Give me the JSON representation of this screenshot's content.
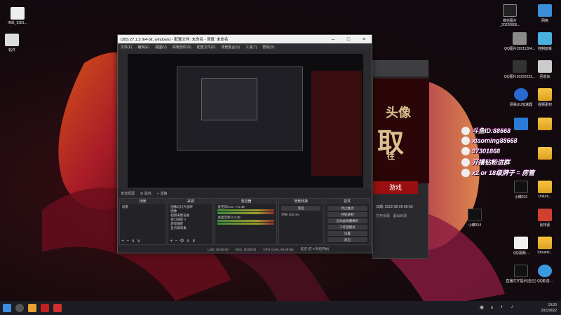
{
  "desktop": {
    "icons": [
      {
        "label": "IMG_5381..."
      },
      {
        "label": "帖件"
      },
      {
        "label": "微信图片_20220805..."
      },
      {
        "label": "网络"
      },
      {
        "label": "QQ图片20211204..."
      },
      {
        "label": "控制面板"
      },
      {
        "label": "QQ图片20220223..."
      },
      {
        "label": "回收站"
      },
      {
        "label": "网易UU加速器"
      },
      {
        "label": "视频素材"
      },
      {
        "label": "小精232"
      },
      {
        "label": "Unturn..."
      },
      {
        "label": "小精314"
      },
      {
        "label": "比特素"
      },
      {
        "label": "QQ视频..."
      },
      {
        "label": "Streaml..."
      },
      {
        "label": "直播文字提示(自己)"
      },
      {
        "label": "QQ影音..."
      }
    ]
  },
  "overlay_lines": [
    "斗鱼ID:88668",
    "xiaoming88668",
    "97301868",
    "开播钻粉进群",
    "x2 or 18级牌子 = 房管"
  ],
  "obs": {
    "title": "OBS 27.1.3 (64-bit, windows) - 配置文件: 未命名 - 场景: 未命名",
    "menu": [
      "文件(F)",
      "编辑(E)",
      "视图(V)",
      "停靠部件(D)",
      "配置文件(P)",
      "场景集合(S)",
      "工具(T)",
      "帮助(H)"
    ],
    "source_bar": {
      "label": "未选择源",
      "props": "属性",
      "filters": "滤镜"
    },
    "docks": {
      "scenes": {
        "title": "场景",
        "items": [
          "场景"
        ]
      },
      "sources": {
        "title": "来源",
        "items": [
          "图像幻灯片放映",
          "图像",
          "视频采集设备",
          "窗口捕获 3",
          "游戏捕获",
          "显示器采集"
        ]
      },
      "mixer": {
        "title": "混音器",
        "items": [
          "麦克风/Aux",
          "桌面音频"
        ],
        "levels": [
          "-7.6 dB",
          "0.0 dB"
        ]
      },
      "transitions": {
        "title": "场景转换",
        "type": "渐变",
        "duration_label": "时长",
        "duration": "300 ms"
      },
      "controls": {
        "title": "控件",
        "buttons": [
          "停止推流",
          "开始录制",
          "启动虚拟摄像机",
          "工作室模式",
          "设置",
          "退出"
        ]
      }
    },
    "status": {
      "live": "LIVE: 00:00:00",
      "rec": "REC: 00:00:00",
      "cpu": "CPU: 0.4%, 60.00 fps",
      "note": "延迟 (在 5 秒后开始)"
    }
  },
  "side_window": {
    "chars": [
      "头像",
      "取",
      "往"
    ],
    "game_button": "游戏",
    "date": "日期: 2022-08-20-09-55",
    "links": [
      "打开目录",
      "退出目录"
    ]
  },
  "taskbar": {
    "time": "19:50",
    "date": "2022/8/22"
  }
}
